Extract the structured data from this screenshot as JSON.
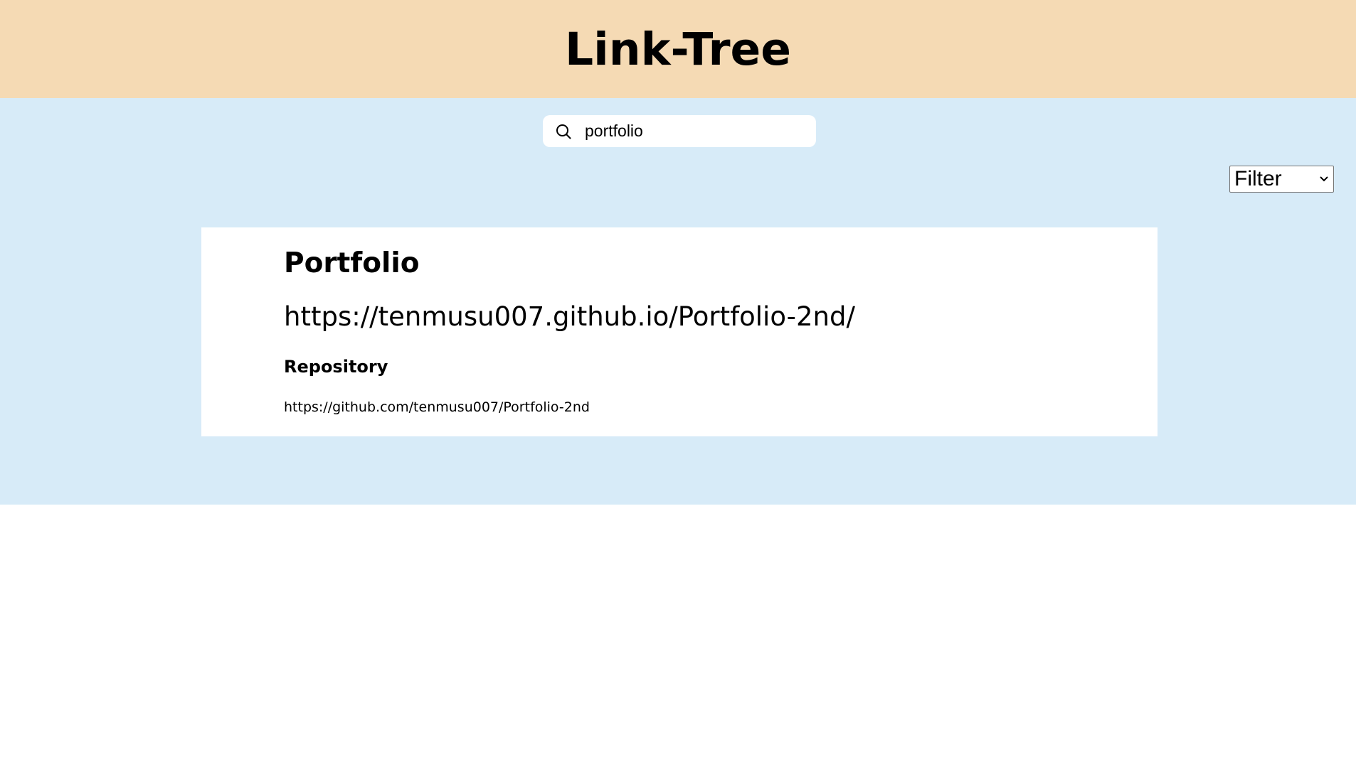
{
  "header": {
    "title": "Link-Tree"
  },
  "search": {
    "icon": "search-icon",
    "value": "portfolio",
    "placeholder": ""
  },
  "filter": {
    "selected": "Filter",
    "icon": "chevron-down-icon"
  },
  "results": [
    {
      "title": "Portfolio",
      "url": "https://tenmusu007.github.io/Portfolio-2nd/",
      "repo_label": "Repository",
      "repo_url": "https://github.com/tenmusu007/Portfolio-2nd"
    }
  ],
  "colors": {
    "header_bg": "#f5dab4",
    "main_bg": "#d7ebf8",
    "card_bg": "#ffffff"
  }
}
